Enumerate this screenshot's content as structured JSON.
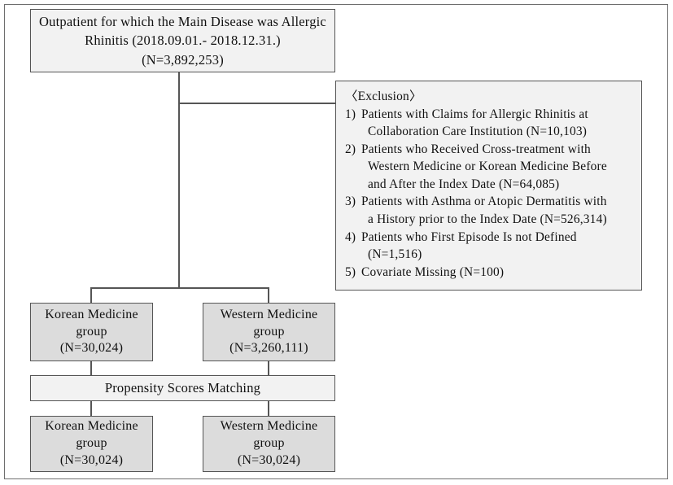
{
  "diagram": {
    "source_box": {
      "line1": "Outpatient for which the Main Disease was Allergic",
      "line2": "Rhinitis (2018.09.01.- 2018.12.31.)",
      "line3": "(N=3,892,253)"
    },
    "exclusion_box": {
      "title": "〈Exclusion〉",
      "items": [
        {
          "number": "1)",
          "line1": "Patients with Claims for Allergic Rhinitis at",
          "line2": "Collaboration Care Institution (N=10,103)"
        },
        {
          "number": "2)",
          "line1": "Patients who Received Cross-treatment with",
          "line2": "Western Medicine or Korean Medicine Before",
          "line3": "and After the Index Date (N=64,085)"
        },
        {
          "number": "3)",
          "line1": "Patients with Asthma or Atopic Dermatitis with",
          "line2": "a History prior to the Index Date (N=526,314)"
        },
        {
          "number": "4)",
          "line1": "Patients who First Episode Is not Defined",
          "line2": "(N=1,516)"
        },
        {
          "number": "5)",
          "line1": "Covariate Missing (N=100)"
        }
      ]
    },
    "korean_group_pre": {
      "line1": "Korean Medicine",
      "line2": "group",
      "line3": "(N=30,024)"
    },
    "western_group_pre": {
      "line1": "Western Medicine",
      "line2": "group",
      "line3": "(N=3,260,111)"
    },
    "matching_step": {
      "label": "Propensity Scores Matching"
    },
    "korean_group_post": {
      "line1": "Korean Medicine",
      "line2": "group",
      "line3": "(N=30,024)"
    },
    "western_group_post": {
      "line1": "Western Medicine",
      "line2": "group",
      "line3": "(N=30,024)"
    }
  },
  "colors": {
    "box_border": "#555555",
    "box_fill_light": "#f2f2f2",
    "box_fill_shade": "#dcdcdc",
    "frame_border": "#6e6e6e",
    "connector": "#555555",
    "text": "#111111"
  }
}
